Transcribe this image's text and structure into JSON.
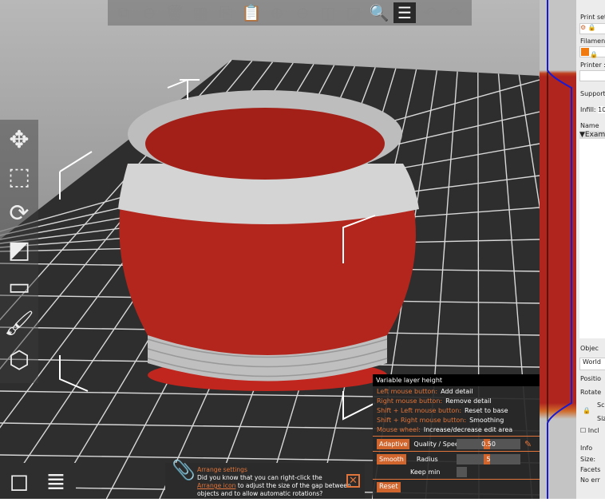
{
  "toolbar": {
    "items": [
      {
        "name": "add-icon",
        "glyph": "⧉"
      },
      {
        "name": "delete-icon",
        "glyph": "⊖"
      },
      {
        "name": "delete-all-icon",
        "glyph": "🗑"
      },
      {
        "name": "arrange-icon",
        "glyph": "▦"
      },
      {
        "name": "copy-icon",
        "glyph": "⎘"
      },
      {
        "name": "paste-icon",
        "glyph": "📋"
      },
      {
        "name": "add-instance-icon",
        "glyph": "⊕"
      },
      {
        "name": "remove-instance-icon",
        "glyph": "⊖"
      },
      {
        "name": "split-objects-icon",
        "glyph": "◫"
      },
      {
        "name": "split-parts-icon",
        "glyph": "◪"
      },
      {
        "name": "search-icon",
        "glyph": "🔍"
      },
      {
        "name": "variable-layer-height-icon",
        "glyph": "☰"
      },
      {
        "name": "undo-icon",
        "glyph": "↶"
      },
      {
        "name": "redo-icon",
        "glyph": "↷"
      }
    ]
  },
  "left_tools": [
    {
      "name": "move-icon",
      "glyph": "✥"
    },
    {
      "name": "scale-icon",
      "glyph": "⬚"
    },
    {
      "name": "rotate-icon",
      "glyph": "⟳"
    },
    {
      "name": "place-on-face-icon",
      "glyph": "◩"
    },
    {
      "name": "cut-icon",
      "glyph": "▭"
    },
    {
      "name": "paint-supports-icon",
      "glyph": "🖌"
    },
    {
      "name": "view-cube-icon",
      "glyph": "⬡"
    }
  ],
  "bottom_left": [
    {
      "name": "3d-view-icon",
      "glyph": "◻"
    },
    {
      "name": "preview-layers-icon",
      "glyph": "≣"
    }
  ],
  "vlh": {
    "title": "Variable layer height",
    "hints": [
      {
        "key": "Left mouse button:",
        "desc": "Add detail"
      },
      {
        "key": "Right mouse button:",
        "desc": "Remove detail"
      },
      {
        "key": "Shift + Left mouse button:",
        "desc": "Reset to base"
      },
      {
        "key": "Shift + Right mouse button:",
        "desc": "Smoothing"
      },
      {
        "key": "Mouse wheel:",
        "desc": "Increase/decrease edit area"
      }
    ],
    "adaptive": "Adaptive",
    "quality_label": "Quality / Speed",
    "quality_value": "0.50",
    "smooth": "Smooth",
    "radius_label": "Radius",
    "radius_value": "5",
    "keep_min": "Keep min",
    "reset": "Reset"
  },
  "notification": {
    "title": "Arrange settings",
    "line1": "Did you know that you can right-click the",
    "link": "Arrange icon",
    "line2": " to adjust the size of the gap between",
    "line3": "objects and to allow automatic rotations?"
  },
  "sidebar": {
    "print_settings": "Print sett",
    "filament": "Filament",
    "printer": "Printer :",
    "supports": "Support",
    "infill": "Infill:",
    "infill_value": "10",
    "name_header": "Name",
    "object": "▼Exam",
    "object_manip": "Objec",
    "coord": "World",
    "position": "Positio",
    "rotate": "Rotate",
    "scale": "Sca",
    "size": "Siz",
    "inches": "Incl",
    "info": "Info",
    "info_size": "Size:",
    "facets": "Facets",
    "errors": "No err"
  },
  "colors": {
    "accent": "#d0652e",
    "model": "#b0261e"
  }
}
